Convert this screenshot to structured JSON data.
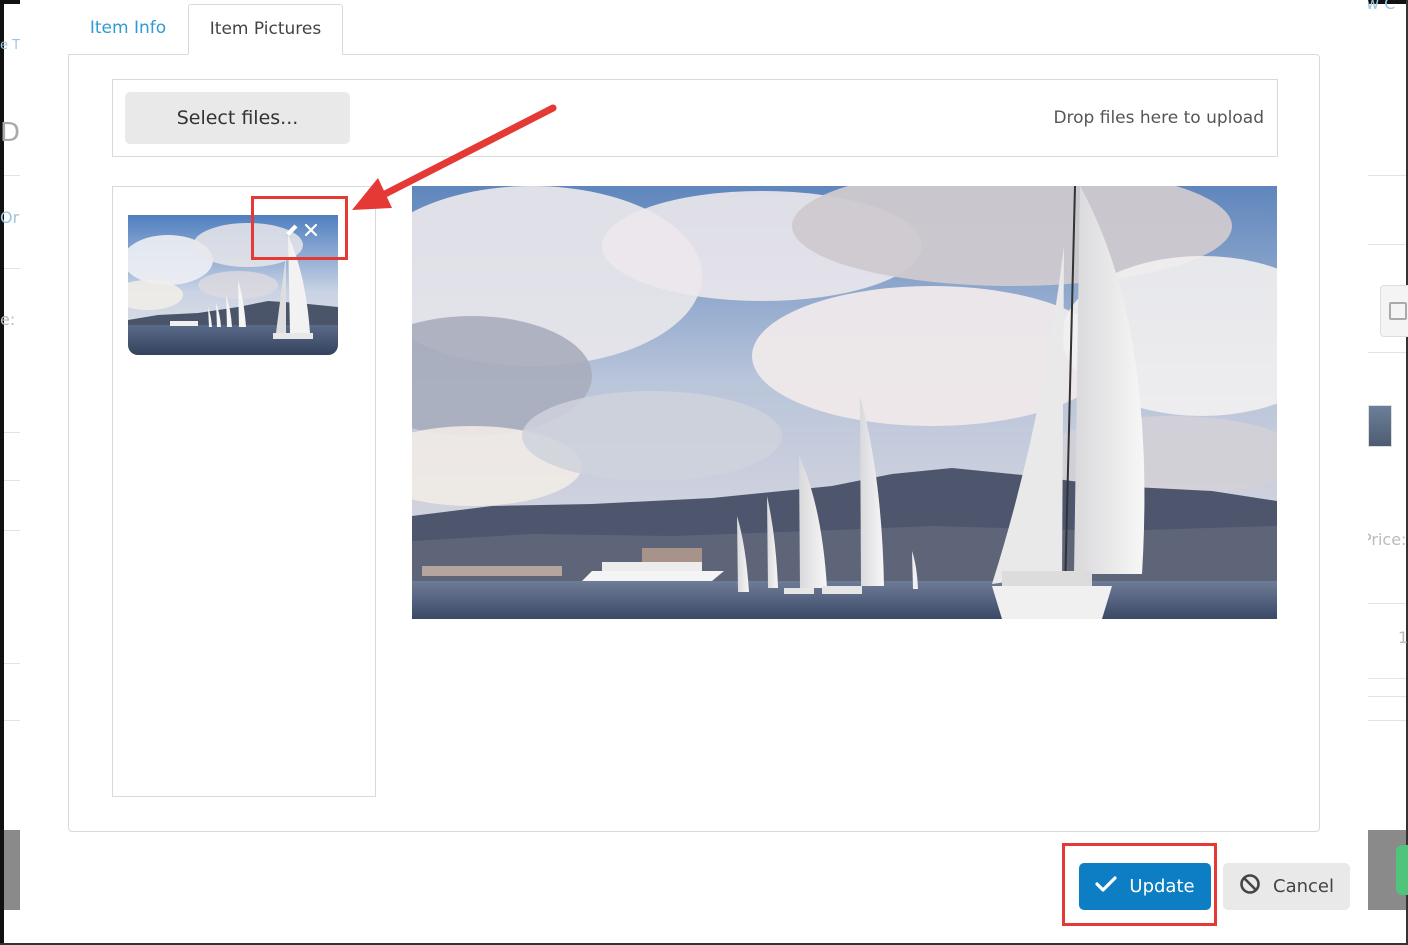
{
  "dialog": {
    "tabs": [
      {
        "label": "Item Info",
        "active": false
      },
      {
        "label": "Item Pictures",
        "active": true
      }
    ],
    "upload": {
      "select_label": "Select files...",
      "drop_hint": "Drop files here to upload"
    },
    "thumbnail": {
      "actions": [
        {
          "icon": "pencil-icon",
          "label": "edit"
        },
        {
          "icon": "close-icon",
          "label": "remove"
        }
      ]
    },
    "footer": {
      "update_label": "Update",
      "cancel_label": "Cancel"
    }
  },
  "background": {
    "fragments": [
      "e T",
      "D",
      "Or",
      "e:",
      "Price:",
      "1",
      "w C"
    ]
  },
  "colors": {
    "accent": "#0d7ec3",
    "tab_link": "#2f9ad4",
    "annotation": "#e53935"
  }
}
